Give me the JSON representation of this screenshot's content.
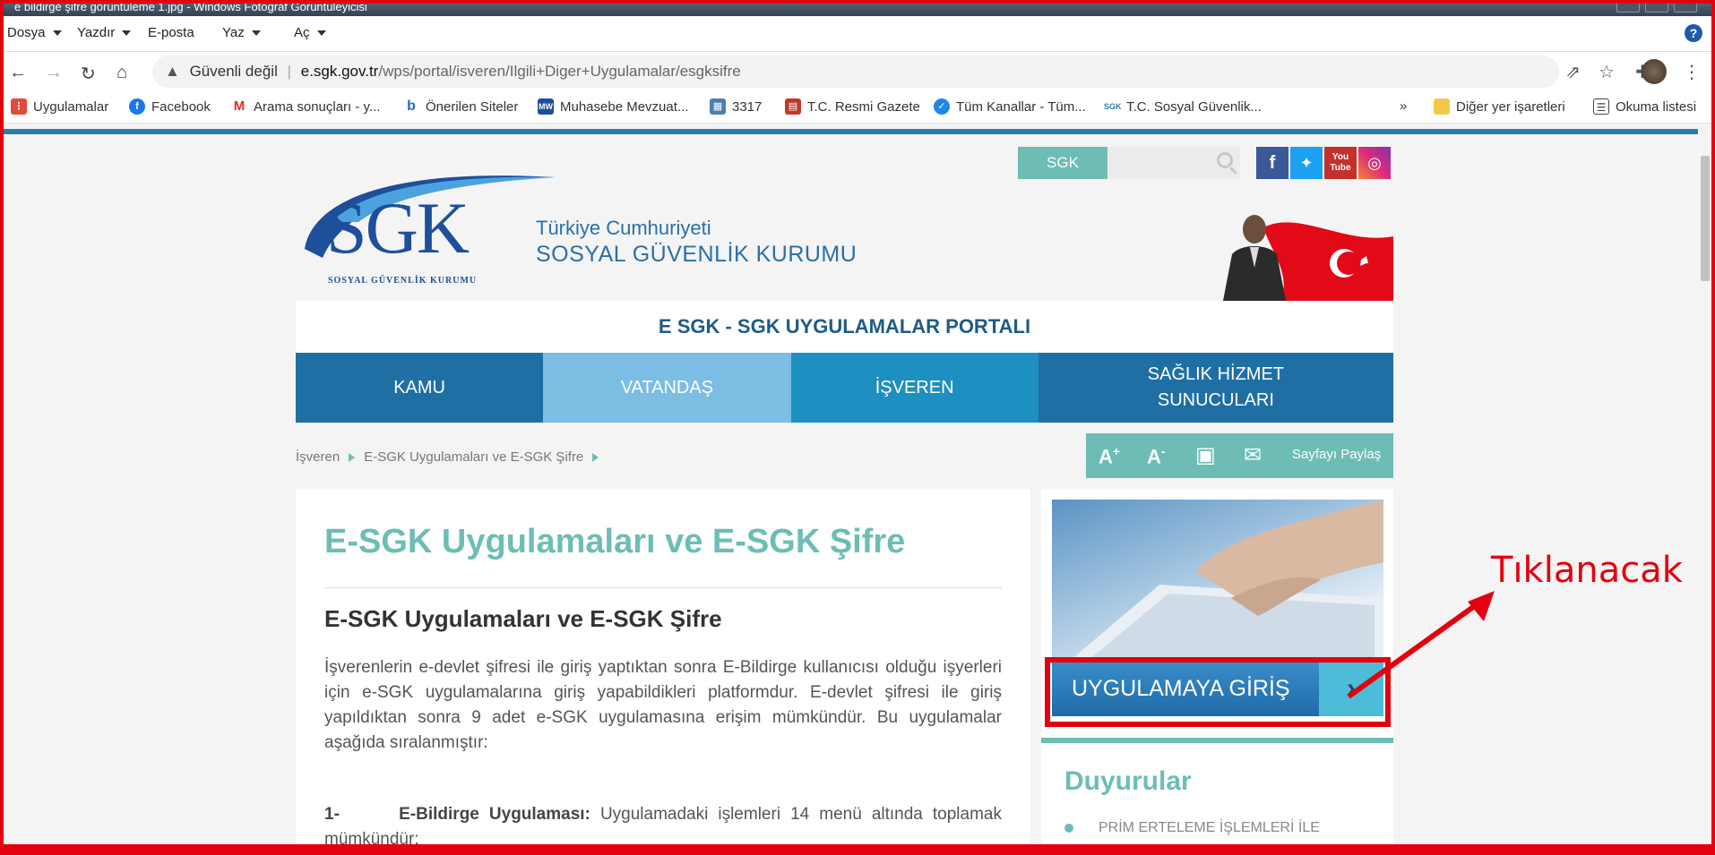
{
  "window": {
    "title": "e bildirge şifre görüntüleme 1.jpg - Windows Fotoğraf Görüntüleyicisi"
  },
  "menubar": {
    "items": [
      {
        "label": "Dosya",
        "caret": true
      },
      {
        "label": "Yazdır",
        "caret": true
      },
      {
        "label": "E-posta",
        "caret": false
      },
      {
        "label": "Yaz",
        "caret": true
      },
      {
        "label": "Aç",
        "caret": true
      }
    ],
    "help": "?"
  },
  "browser": {
    "security": "Güvenli değil",
    "url_host": "e.sgk.gov.tr",
    "url_path": "/wps/portal/isveren/Ilgili+Diger+Uygulamalar/esgksifre"
  },
  "bookmarks": {
    "items": [
      {
        "label": "Uygulamalar",
        "icon": "apps-grid-icon",
        "color": "#e04b3a"
      },
      {
        "label": "Facebook",
        "icon": "facebook-icon",
        "color": "#1877f2"
      },
      {
        "label": "Arama sonuçları - y...",
        "icon": "gmail-icon",
        "color": "#d93025"
      },
      {
        "label": "Önerilen Siteler",
        "icon": "bing-icon",
        "color": "#1f6fc5"
      },
      {
        "label": "Muhasebe Mevzuat...",
        "icon": "mw-icon",
        "color": "#1d4f9a"
      },
      {
        "label": "3317",
        "icon": "calendar-icon",
        "color": "#4a7fb5"
      },
      {
        "label": "T.C. Resmi Gazete",
        "icon": "gazete-icon",
        "color": "#c0392b"
      },
      {
        "label": "Tüm Kanallar - Tüm...",
        "icon": "channels-icon",
        "color": "#1e88e5"
      },
      {
        "label": "T.C. Sosyal Güvenlik...",
        "icon": "sgk-small-icon",
        "color": "#2a7fa8"
      }
    ],
    "overflow": "»",
    "other": "Diğer yer işaretleri",
    "reading": "Okuma listesi"
  },
  "site": {
    "search_chip": "SGK",
    "logo": "SGK",
    "logo_sub": "SOSYAL GÜVENLİK KURUMU",
    "institution_line1": "Türkiye Cumhuriyeti",
    "institution_line2": "SOSYAL GÜVENLİK KURUMU",
    "portal_title": "E SGK - SGK UYGULAMALAR PORTALI",
    "nav": [
      {
        "label": "KAMU",
        "color": "#1f6fa5"
      },
      {
        "label": "VATANDAŞ",
        "color": "#7bbde3"
      },
      {
        "label": "İŞVEREN",
        "color": "#1d8fc0"
      },
      {
        "label": "SAĞLIK HİZMET SUNUCULARI",
        "color": "#1f6fa5"
      }
    ],
    "breadcrumb": [
      "İşveren",
      "E-SGK Uygulamaları ve E-SGK Şifre"
    ],
    "tools": {
      "font_up": "A",
      "font_down": "A",
      "share": "Sayfayı Paylaş"
    }
  },
  "article": {
    "h1": "E-SGK Uygulamaları ve E-SGK Şifre",
    "h2": "E-SGK Uygulamaları ve E-SGK Şifre",
    "intro": "İşverenlerin e-devlet şifresi ile giriş yaptıktan sonra E-Bildirge kullanıcısı olduğu işyerleri için e-SGK uygulamalarına giriş yapabildikleri platformdur. E-devlet şifresi ile giriş yapıldıktan sonra 9 adet e-SGK uygulamasına erişim mümkündür. Bu uygulamalar aşağıda sıralanmıştır:",
    "item1_num": "1-",
    "item1_title": "E-Bildirge Uygulaması:",
    "item1_text": "Uygulamadaki işlemleri 14 menü altında toplamak mümkündür:"
  },
  "sidebar": {
    "enter_label": "UYGULAMAYA GİRİŞ",
    "announcements_title": "Duyurular",
    "announcement_1": "PRİM ERTELEME İŞLEMLERİ İLE"
  },
  "annotation": {
    "callout": "Tıklanacak",
    "color": "#e3000f"
  }
}
